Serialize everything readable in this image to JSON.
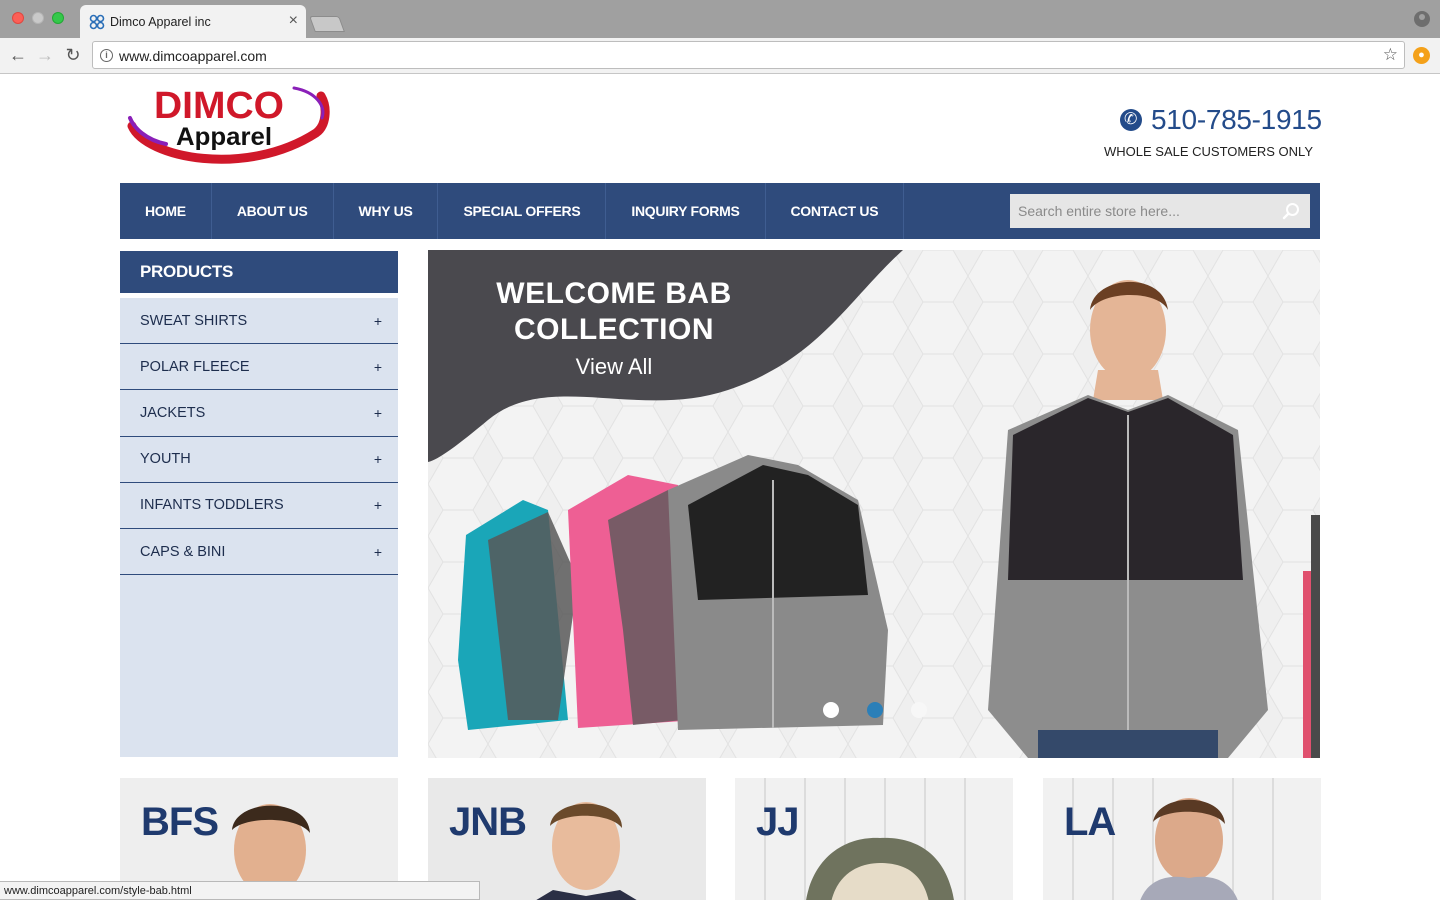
{
  "browser": {
    "tab_title": "Dimco Apparel inc",
    "url": "www.dimcoapparel.com",
    "status_url": "www.dimcoapparel.com/style-bab.html"
  },
  "header": {
    "logo_top": "DIMCO",
    "logo_bottom": "Apparel",
    "phone": "510-785-1915",
    "phone_note": "WHOLE SALE CUSTOMERS ONLY"
  },
  "nav": {
    "items": [
      "HOME",
      "ABOUT US",
      "WHY US",
      "SPECIAL OFFERS",
      "INQUIRY FORMS",
      "CONTACT US"
    ],
    "search_placeholder": "Search entire store here..."
  },
  "sidebar": {
    "title": "PRODUCTS",
    "items": [
      {
        "label": "SWEAT SHIRTS",
        "expand": "+"
      },
      {
        "label": "POLAR FLEECE",
        "expand": "+"
      },
      {
        "label": "JACKETS",
        "expand": "+"
      },
      {
        "label": "YOUTH",
        "expand": "+"
      },
      {
        "label": "INFANTS TODDLERS",
        "expand": "+"
      },
      {
        "label": "CAPS & BINI",
        "expand": "+"
      }
    ]
  },
  "banner": {
    "title_line1": "WELCOME BAB",
    "title_line2": "COLLECTION",
    "link": "View All",
    "slide_count": 3,
    "active_slide": 2
  },
  "brands": [
    {
      "label": "BFS"
    },
    {
      "label": "JNB"
    },
    {
      "label": "JJ"
    },
    {
      "label": "LA"
    }
  ],
  "colors": {
    "primary": "#2f4b7c",
    "logo_red": "#d0182a",
    "sidebar_bg": "#dbe3ef",
    "banner_dark": "#4a494e",
    "dot_active": "#2b7fb8"
  }
}
